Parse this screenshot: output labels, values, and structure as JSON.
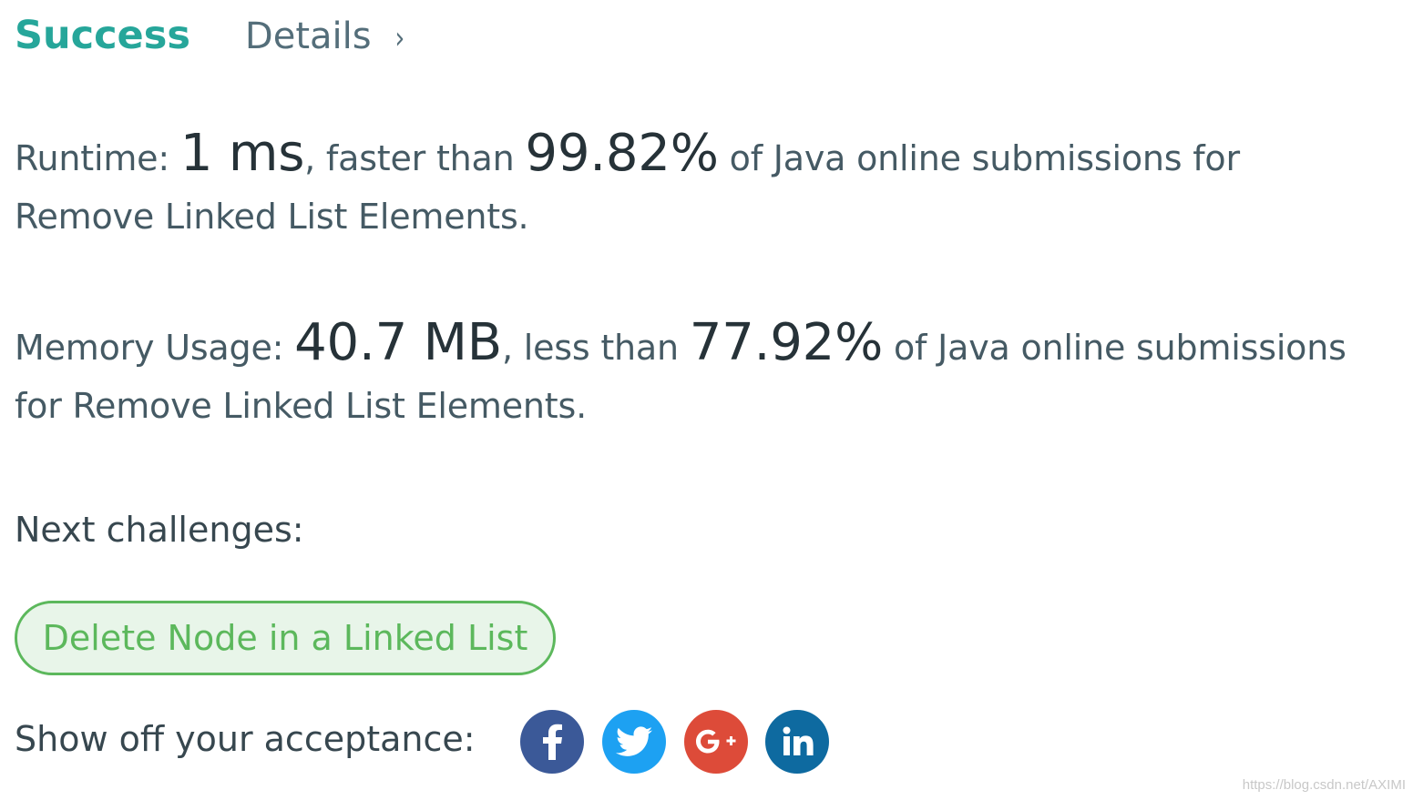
{
  "header": {
    "status": "Success",
    "details_label": "Details",
    "chevron": "›"
  },
  "runtime": {
    "label": "Runtime:",
    "value": "1 ms",
    "comparison": ", faster than",
    "percent": "99.82%",
    "suffix": "of Java online submissions for Remove Linked List Elements."
  },
  "memory": {
    "label": "Memory Usage:",
    "value": "40.7 MB",
    "comparison": ", less than",
    "percent": "77.92%",
    "suffix": "of Java online submissions for Remove Linked List Elements."
  },
  "next": {
    "label": "Next challenges:",
    "challenges": [
      "Delete Node in a Linked List"
    ]
  },
  "share": {
    "label": "Show off your acceptance:",
    "icons": [
      "facebook-icon",
      "twitter-icon",
      "google-plus-icon",
      "linkedin-icon"
    ],
    "colors": {
      "facebook": "#3b5998",
      "twitter": "#1da1f2",
      "google_plus": "#dd4b39",
      "linkedin": "#0e6aa0"
    }
  },
  "watermark": "https://blog.csdn.net/AXIMI",
  "colors": {
    "success": "#26a69a",
    "challenge_border": "#5cb85c",
    "challenge_bg": "#e8f5e9"
  }
}
